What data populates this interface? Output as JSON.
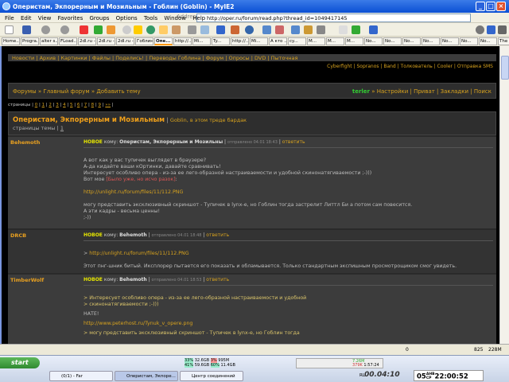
{
  "window": {
    "title": "Оперистам, Экпорерным и Мозильным - Гоблин (Goblin) - MyIE2"
  },
  "menu": [
    "File",
    "Edit",
    "View",
    "Favorites",
    "Groups",
    "Options",
    "Tools",
    "Window",
    "Help"
  ],
  "address": {
    "label": "Address",
    "url": "http://oper.ru/forum/read.php?thread_id=1049417145"
  },
  "tabs": [
    "Home...",
    "Progra...",
    "alter s...",
    "FLoad...",
    "2dl.ru -...",
    "2dl.ru -...",
    "2dl.ru -...",
    "Гоблин...",
    "Опе...",
    "http://...",
    "Mi...",
    "Ty...",
    "http://...",
    "Mi...",
    "А кто ...",
    "cy...",
    "M...",
    "M...",
    "M...",
    "No...",
    "No...",
    "No...",
    "No...",
    "No...",
    "No...",
    "No...",
    "The R..."
  ],
  "active_tab": 8,
  "site": {
    "nav": "Новости | Архив | Картинки | Файлы | Поделись! | Переводы Гоблина | Форум | Опросы | DVD | Пыточная",
    "right_links": "Cyberfight | Sopranos | Band | Толкователь | Cooler | Отправка SMS",
    "breadcrumb": "Форумы » Главный форум » Добавить тему",
    "user": "terler",
    "user_links": " » Настройки | Приват | Закладки | Поиск",
    "pages_label": "страницы |",
    "pages": [
      "0",
      "1",
      "2",
      "3",
      "4",
      "5",
      "6",
      "7",
      "8",
      "9",
      "»»"
    ],
    "thread_title": "Оперистам, Экпорерным и Мозильным",
    "thread_sub": "Goblin, в этом треде бардак",
    "thread_pages_label": "страницы темы |",
    "thread_page": "1"
  },
  "posts": [
    {
      "author": "Behemoth",
      "new": "НОВОЕ",
      "to_label": "кому:",
      "to": "Оперистам, Экпорерным и Мозильны",
      "sent": "отправлено 04.01 18:43",
      "reply": "ответить",
      "lines": [
        "А вот как у вас тупичек выглядет в браузере?",
        "А-да кидайте ваши кOртинки, давайте сравнивать!",
        "Интересует особливо опера - из-за ее лего-образной настраиваемости и удобной скинонатягиваемости ;-)))"
      ],
      "line4": "Вот мое ",
      "red": "[Было уже, но исчо разок]",
      "link": "http://unlight.ru/forum/files/11/112.PNG",
      "lines2": [
        "могу представить эксклюзивный скриншот - Тупичек в lynx-е, но Гоблин тогда застрелит Литтл Би а потом сам повесится.",
        "А эти кадры - весьма ценны!",
        ";-))"
      ]
    },
    {
      "author": "DRCB",
      "new": "НОВОЕ",
      "to_label": "кому:",
      "to": "Behemoth",
      "sent": "отправлено 04.01 18:48",
      "reply": "ответить",
      "quote_link": "http://unlight.ru/forum/files/11/112.PNG",
      "text": "Этот пнг-шник битый. Иксплорер пытается его показать и обламывается. Только стандартным экспишным просмотрощиком смог увидеть."
    },
    {
      "author": "TimberWolf",
      "new": "НОВОЕ",
      "to_label": "кому:",
      "to": "Behemoth",
      "sent": "отправлено 04.01 18:53",
      "reply": "ответить",
      "quotes": [
        "> Интересует особливо опера - из-за ее лего-образной настраиваемости и удобной",
        "> скинонатягиваемости ;-)))"
      ],
      "text": "НАТЕ!",
      "link": "http://www.peterhost.ru/Tynuk_v_opere.png",
      "cut": "> могу представить эксклюзивный скриншот - Тупичек в lynx-е, но Гоблин тогда"
    }
  ],
  "status": {
    "count": "0",
    "a": "825",
    "b": "228M"
  },
  "taskbar": {
    "start": "start",
    "tasks": [
      "(0/1) - Far",
      "Оперистам, Экпоре...",
      "Центр соединений"
    ],
    "stats": [
      "33%",
      "32.6GB",
      "3%",
      "995M",
      "41%",
      "59.6GB",
      "60%",
      "11.4GB"
    ],
    "net": [
      "7.26M",
      "379K",
      "1:57:24"
    ],
    "timer": "00.04:10",
    "date": "05",
    "month": "АНВ",
    "weekday": "СР",
    "time": "22:00:52",
    "lang": "RL"
  }
}
